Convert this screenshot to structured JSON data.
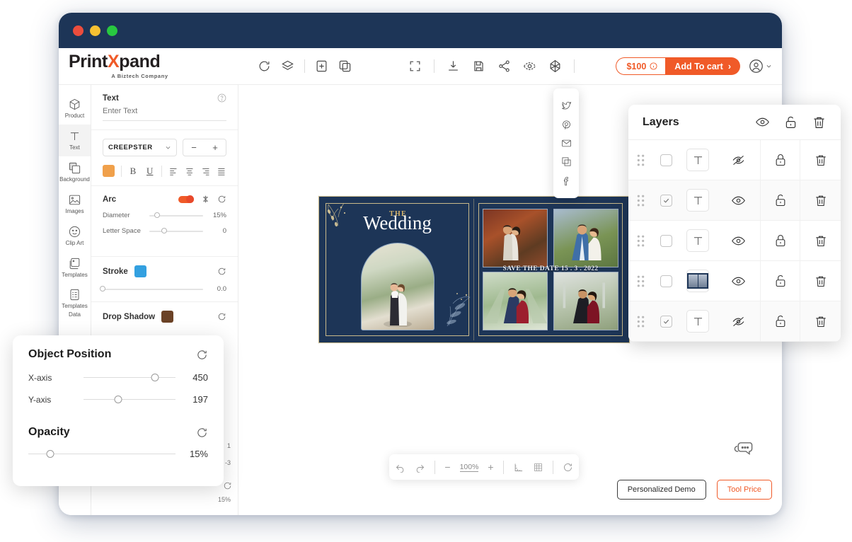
{
  "window": {
    "traffic_lights": [
      "close",
      "minimize",
      "maximize"
    ]
  },
  "header": {
    "brand_part1": "Print",
    "brand_x": "X",
    "brand_part2": "pand",
    "tagline": "A Biztech Company",
    "tools_left": [
      {
        "name": "refresh-icon",
        "label": "Refresh"
      },
      {
        "name": "layers-icon",
        "label": "Layers"
      },
      {
        "name": "add-page-icon",
        "label": "Add Page"
      },
      {
        "name": "duplicate-icon",
        "label": "Duplicate"
      }
    ],
    "tools_right": [
      {
        "name": "fullscreen-icon",
        "label": "Fullscreen"
      },
      {
        "name": "download-icon",
        "label": "Download"
      },
      {
        "name": "save-icon",
        "label": "Save"
      },
      {
        "name": "share-icon",
        "label": "Share"
      },
      {
        "name": "preview-icon",
        "label": "Preview"
      },
      {
        "name": "three-d-icon",
        "label": "3D View"
      }
    ],
    "price": "$100",
    "add_to_cart": "Add To cart",
    "cart_chevron": "›"
  },
  "sidebar": {
    "items": [
      {
        "label": "Product",
        "icon": "cube-icon",
        "active": false
      },
      {
        "label": "Text",
        "icon": "text-t-icon",
        "active": true
      },
      {
        "label": "Background",
        "icon": "background-icon",
        "active": false
      },
      {
        "label": "Images",
        "icon": "image-icon",
        "active": false
      },
      {
        "label": "Clip Art",
        "icon": "smiley-icon",
        "active": false
      },
      {
        "label": "Templates",
        "icon": "templates-icon",
        "active": false
      },
      {
        "label": "Templates Data",
        "label_line1": "Templates",
        "label_line2": "Data",
        "icon": "clipboard-icon",
        "active": false
      }
    ]
  },
  "text_panel": {
    "title": "Text",
    "help_icon": "question-icon",
    "input_placeholder": "Enter Text",
    "input_value": "",
    "font_family": "CREEPSTER",
    "font_decrease": "−",
    "font_increase": "+",
    "color_swatch": "#f0a04b",
    "bold": "B",
    "underline": "U",
    "align_options": [
      "align-left",
      "align-center",
      "align-right",
      "align-justify"
    ],
    "arc": {
      "title": "Arc",
      "toggle_on": true,
      "flip_icon": "flip-icon",
      "reset_icon": "reset-icon",
      "diameter_label": "Diameter",
      "diameter_value": "15%",
      "diameter_pct": 15,
      "letterspace_label": "Letter Space",
      "letterspace_value": "0",
      "letterspace_pct": 28
    },
    "stroke": {
      "title": "Stroke",
      "color": "#33a0e0",
      "value": "0.0",
      "pct": 0,
      "reset_icon": "reset-icon"
    },
    "drop_shadow": {
      "title": "Drop Shadow",
      "color": "#6b4226",
      "reset_icon": "reset-icon",
      "hidden_value_1": "1",
      "hidden_value_2": "-3",
      "hidden_value_3": "15%"
    }
  },
  "object_position_card": {
    "title": "Object Position",
    "reset_icon": "reset-icon",
    "x_label": "X-axis",
    "x_value": "450",
    "x_pct": 78,
    "y_label": "Y-axis",
    "y_value": "197",
    "y_pct": 38,
    "opacity_title": "Opacity",
    "opacity_reset_icon": "reset-icon",
    "opacity_value": "15%",
    "opacity_pct": 15
  },
  "share_popup": {
    "items": [
      {
        "name": "twitter-icon",
        "label": "Twitter"
      },
      {
        "name": "pinterest-icon",
        "label": "Pinterest"
      },
      {
        "name": "email-icon",
        "label": "Email"
      },
      {
        "name": "copy-icon",
        "label": "Copy Link"
      },
      {
        "name": "facebook-icon",
        "label": "Facebook"
      }
    ]
  },
  "layers_panel": {
    "title": "Layers",
    "header_actions": [
      {
        "name": "eye-icon",
        "label": "Toggle visibility"
      },
      {
        "name": "unlock-icon",
        "label": "Unlock all"
      },
      {
        "name": "trash-icon",
        "label": "Delete all"
      }
    ],
    "rows": [
      {
        "type": "text",
        "checked": false,
        "visible": false,
        "locked": true,
        "selected": false
      },
      {
        "type": "text",
        "checked": true,
        "visible": true,
        "locked": false,
        "selected": true
      },
      {
        "type": "text",
        "checked": false,
        "visible": true,
        "locked": true,
        "selected": false
      },
      {
        "type": "image",
        "checked": false,
        "visible": true,
        "locked": false,
        "selected": false
      },
      {
        "type": "text",
        "checked": true,
        "visible": false,
        "locked": false,
        "selected": true
      }
    ]
  },
  "canvas": {
    "design": {
      "left_page": {
        "eyebrow": "THE",
        "title": "Wedding",
        "background_color": "#1d3557",
        "border_color": "#c9b98a",
        "eyebrow_color": "#d8b56a"
      },
      "right_page": {
        "save_the_date": "SAVE THE DATE 15 . 3 . 2022",
        "photo_count": 4
      }
    }
  },
  "zoom_toolbar": {
    "undo_icon": "undo-icon",
    "redo_icon": "redo-icon",
    "minus": "−",
    "zoom_level": "100%",
    "plus": "+",
    "ruler_icon": "ruler-icon",
    "grid_icon": "grid-icon",
    "reset_icon": "reset-icon"
  },
  "footer": {
    "demo_button": "Personalized Demo",
    "price_button": "Tool Price",
    "chat_icon": "chat-bubble-icon"
  }
}
